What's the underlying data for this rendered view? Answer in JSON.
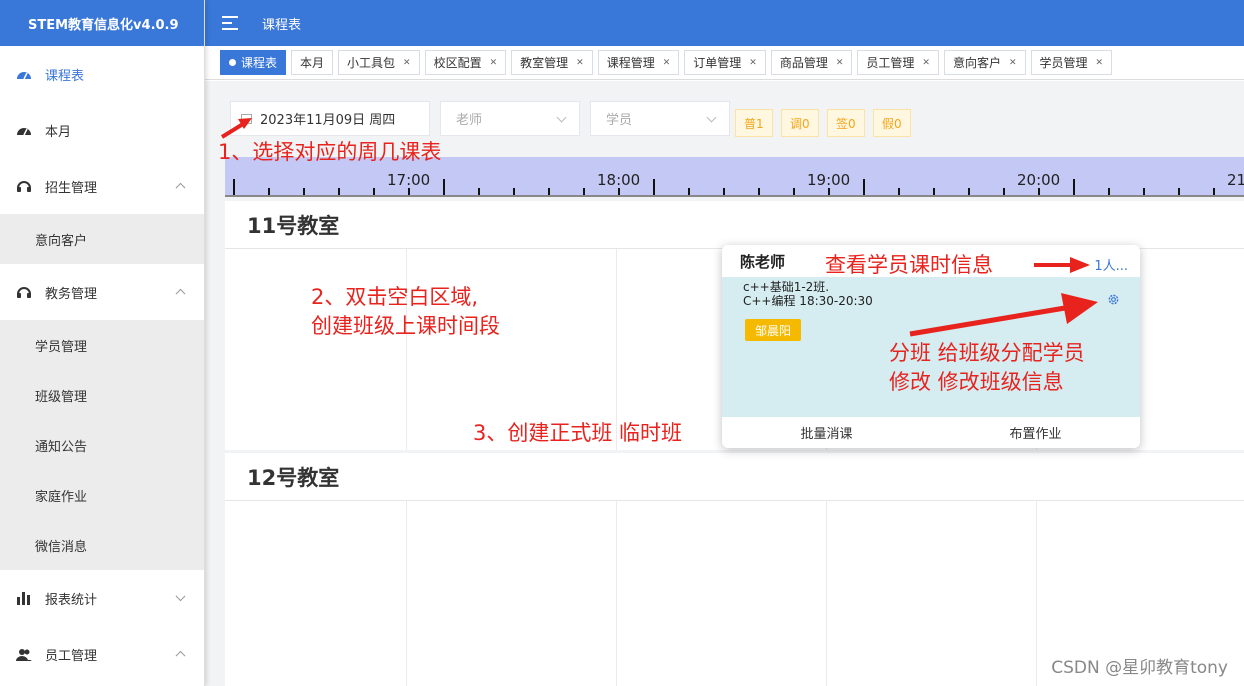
{
  "app": {
    "brand": "STEM教育信息化v4.0.9"
  },
  "sidebar": {
    "items": [
      {
        "label": "课程表",
        "icon": "dashboard-icon",
        "active": true
      },
      {
        "label": "本月",
        "icon": "dashboard-icon"
      },
      {
        "label": "招生管理",
        "icon": "headset-icon",
        "expanded": true,
        "children": [
          "意向客户"
        ]
      },
      {
        "label": "教务管理",
        "icon": "headset-icon",
        "expanded": true,
        "children": [
          "学员管理",
          "班级管理",
          "通知公告",
          "家庭作业",
          "微信消息"
        ]
      },
      {
        "label": "报表统计",
        "icon": "bar-chart-icon",
        "expanded": false
      },
      {
        "label": "员工管理",
        "icon": "users-icon",
        "expanded": true
      }
    ]
  },
  "topbar": {
    "title": "课程表"
  },
  "tags": [
    "课程表",
    "本月",
    "小工具包",
    "校区配置",
    "教室管理",
    "课程管理",
    "订单管理",
    "商品管理",
    "员工管理",
    "意向客户",
    "学员管理"
  ],
  "filters": {
    "date": "2023年11月09日 周四",
    "teacher_placeholder": "老师",
    "student_placeholder": "学员"
  },
  "badges": [
    "普1",
    "调0",
    "签0",
    "假0"
  ],
  "timeline": {
    "labels": [
      "17:00",
      "18:00",
      "19:00",
      "20:00",
      "21"
    ]
  },
  "rooms": [
    {
      "name": "11号教室"
    },
    {
      "name": "12号教室"
    }
  ],
  "class_card": {
    "teacher": "陈老师",
    "count": "1人...",
    "class_name": "c++基础1-2班.",
    "schedule": "C++编程 18:30-20:30",
    "student": "邹晨阳",
    "actions": [
      "批量消课",
      "布置作业"
    ]
  },
  "annotations": {
    "a1": "1、选择对应的周几课表",
    "a2_line1": "2、双击空白区域,",
    "a2_line2": "创建班级上课时间段",
    "a3": "3、创建正式班 临时班",
    "view": "查看学员课时信息",
    "split_line1": "分班  给班级分配学员",
    "split_line2": "修改  修改班级信息"
  },
  "watermark": "CSDN @星卯教育tony",
  "colors": {
    "primary": "#3977d9",
    "annotation": "#e8231e",
    "timeline": "#c4c8f4",
    "card_body": "#d5ecf0",
    "student_tag": "#f5b900"
  }
}
